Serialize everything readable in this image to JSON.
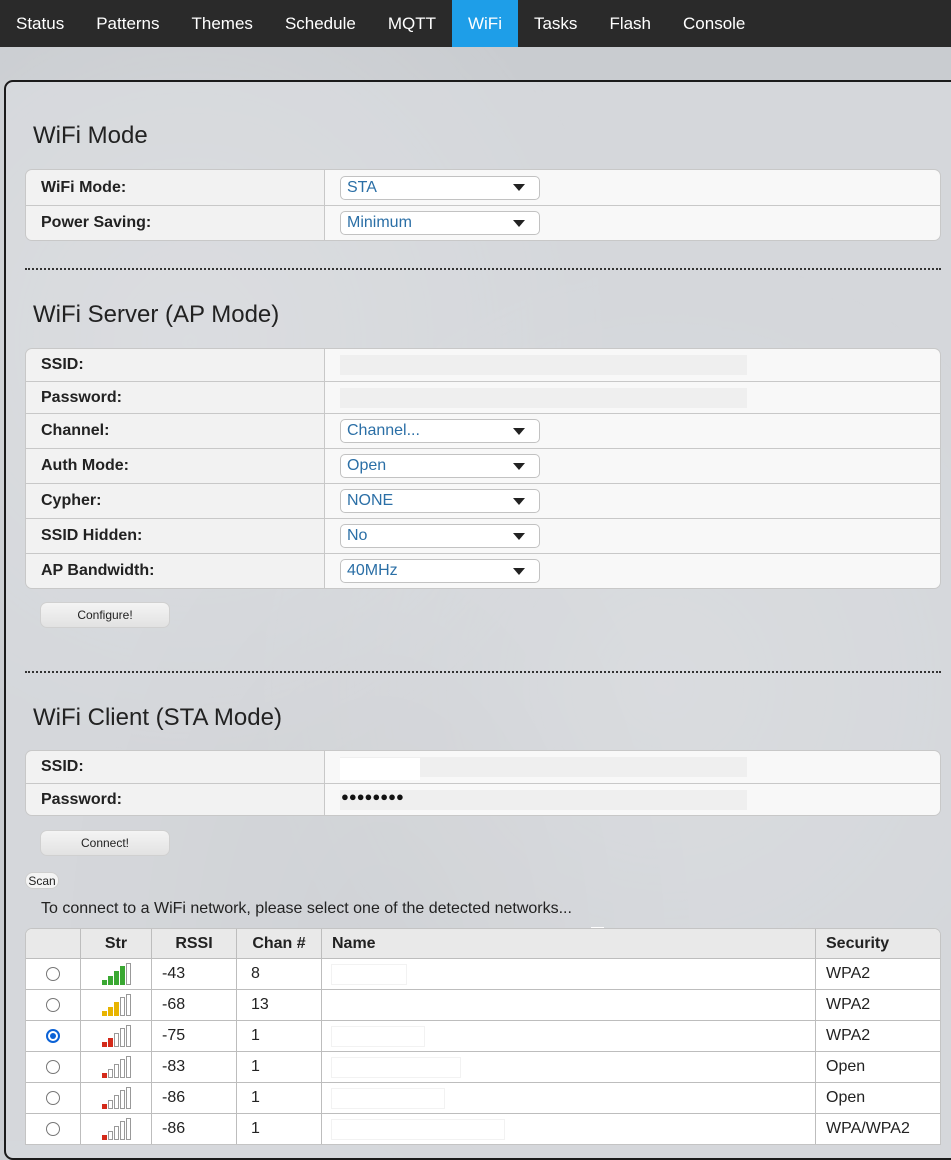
{
  "nav": {
    "items": [
      "Status",
      "Patterns",
      "Themes",
      "Schedule",
      "MQTT",
      "WiFi",
      "Tasks",
      "Flash",
      "Console"
    ],
    "active": "WiFi"
  },
  "mode_section": {
    "title": "WiFi Mode",
    "wifi_mode_label": "WiFi Mode:",
    "wifi_mode_value": "STA",
    "power_saving_label": "Power Saving:",
    "power_saving_value": "Minimum"
  },
  "ap_section": {
    "title": "WiFi Server (AP Mode)",
    "ssid_label": "SSID:",
    "ssid_value": "",
    "password_label": "Password:",
    "password_value": "",
    "channel_label": "Channel:",
    "channel_value": "Channel...",
    "auth_label": "Auth Mode:",
    "auth_value": "Open",
    "cypher_label": "Cypher:",
    "cypher_value": "NONE",
    "hidden_label": "SSID Hidden:",
    "hidden_value": "No",
    "bandwidth_label": "AP Bandwidth:",
    "bandwidth_value": "40MHz",
    "configure_label": "Configure!"
  },
  "sta_section": {
    "title": "WiFi Client (STA Mode)",
    "ssid_label": "SSID:",
    "ssid_value": "",
    "password_label": "Password:",
    "password_value": "●●●●●●●●",
    "connect_label": "Connect!"
  },
  "scan": {
    "button_label": "Scan",
    "hint": "To connect to a WiFi network, please select one of the detected networks...",
    "headers": {
      "str": "Str",
      "rssi": "RSSI",
      "chan": "Chan #",
      "name": "Name",
      "security": "Security"
    },
    "rows": [
      {
        "selected": false,
        "strength_bars": 4,
        "rssi": "-43",
        "chan": "8",
        "name": "",
        "security": "WPA2"
      },
      {
        "selected": false,
        "strength_bars": 3,
        "rssi": "-68",
        "chan": "13",
        "name": "",
        "security": "WPA2"
      },
      {
        "selected": true,
        "strength_bars": 2,
        "rssi": "-75",
        "chan": "1",
        "name": "",
        "security": "WPA2"
      },
      {
        "selected": false,
        "strength_bars": 1,
        "rssi": "-83",
        "chan": "1",
        "name": "",
        "security": "Open"
      },
      {
        "selected": false,
        "strength_bars": 1,
        "rssi": "-86",
        "chan": "1",
        "name": "",
        "security": "Open"
      },
      {
        "selected": false,
        "strength_bars": 1,
        "rssi": "-86",
        "chan": "1",
        "name": "",
        "security": "WPA/WPA2"
      }
    ]
  },
  "colors": {
    "nav_bg": "#2a2a2a",
    "nav_active": "#1e9ee8",
    "select_text": "#2b6fa6",
    "signal_strong": "#3aa832",
    "signal_medium": "#e8b400",
    "signal_weak": "#d42a1a",
    "radio_selected": "#0b62d6"
  }
}
